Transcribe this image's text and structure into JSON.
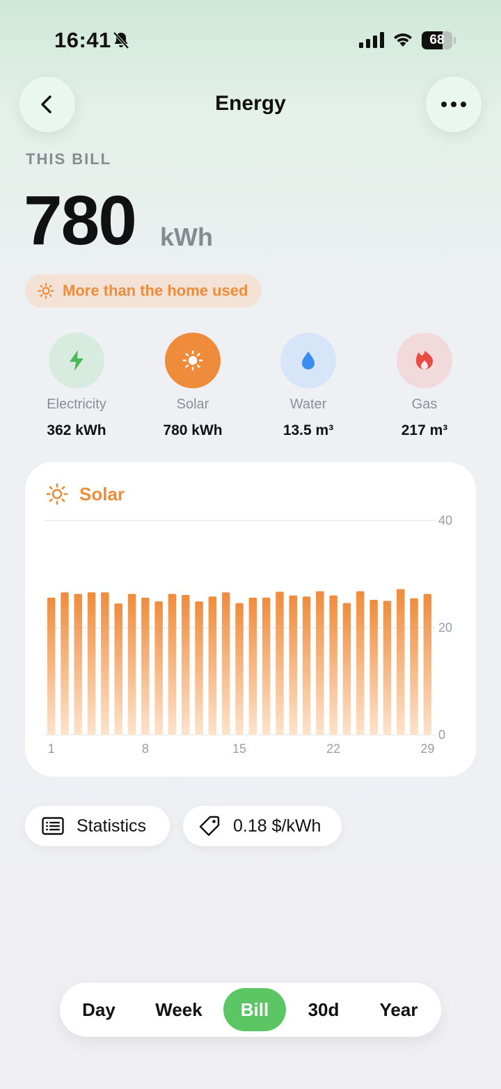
{
  "status_bar": {
    "time": "16:41",
    "battery": "68",
    "battery_level": 0.68
  },
  "nav": {
    "title": "Energy",
    "back_icon": "chevron-left-icon",
    "more_icon": "ellipsis-icon"
  },
  "summary": {
    "label": "THIS BILL",
    "value": "780",
    "unit": "kWh",
    "badge": "More than the home used"
  },
  "categories": [
    {
      "name": "Electricity",
      "value": "362 kWh",
      "icon": "bolt-icon",
      "bg": "#d7ecdf",
      "fg": "#4cb85a"
    },
    {
      "name": "Solar",
      "value": "780 kWh",
      "icon": "sun-icon",
      "bg": "#ef8c3c",
      "fg": "#ffffff"
    },
    {
      "name": "Water",
      "value": "13.5 m³",
      "icon": "drop-icon",
      "bg": "#d6e5f7",
      "fg": "#3a8ef0"
    },
    {
      "name": "Gas",
      "value": "217 m³",
      "icon": "flame-icon",
      "bg": "#f2d9dc",
      "fg": "#ea4b43"
    }
  ],
  "chart_card": {
    "title": "Solar"
  },
  "chart_data": {
    "type": "bar",
    "categories": [
      "1",
      "2",
      "3",
      "4",
      "5",
      "6",
      "7",
      "8",
      "9",
      "10",
      "11",
      "12",
      "13",
      "14",
      "15",
      "16",
      "17",
      "18",
      "19",
      "20",
      "21",
      "22",
      "23",
      "24",
      "25",
      "26",
      "27",
      "28",
      "29"
    ],
    "values": [
      25.6,
      26.6,
      26.3,
      26.6,
      26.6,
      24.5,
      26.3,
      25.6,
      24.9,
      26.3,
      26.1,
      24.9,
      25.8,
      26.6,
      24.6,
      25.6,
      25.6,
      26.7,
      26.0,
      25.8,
      26.8,
      26.0,
      24.6,
      26.8,
      25.2,
      25.0,
      27.2,
      25.5,
      26.3
    ],
    "value_note": "",
    "x_tick_labels": [
      "1",
      "8",
      "15",
      "22",
      "29"
    ],
    "y_tick_labels": [
      "40",
      "20",
      "0"
    ],
    "ylim": [
      0,
      40
    ],
    "grid": true,
    "color": "#ef8c3c"
  },
  "chips": {
    "statistics": "Statistics",
    "price": "0.18 $/kWh"
  },
  "segments": {
    "items": [
      "Day",
      "Week",
      "Bill",
      "30d",
      "Year"
    ],
    "selected": "Bill"
  }
}
